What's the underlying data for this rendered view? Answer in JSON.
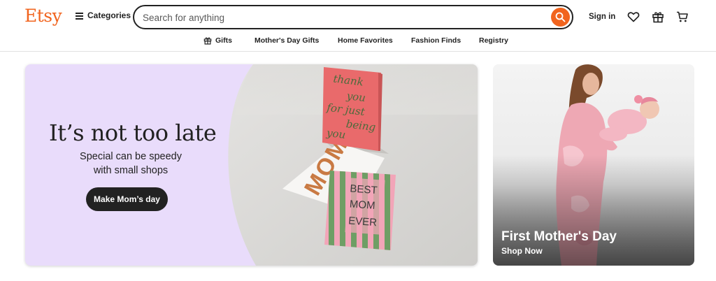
{
  "header": {
    "logo": "Etsy",
    "categories_label": "Categories",
    "search_placeholder": "Search for anything",
    "sign_in": "Sign in"
  },
  "nav": {
    "items": [
      {
        "label": "Gifts",
        "icon": "gift-icon"
      },
      {
        "label": "Mother's Day Gifts"
      },
      {
        "label": "Home Favorites"
      },
      {
        "label": "Fashion Finds"
      },
      {
        "label": "Registry"
      }
    ]
  },
  "hero": {
    "title": "It’s not too late",
    "subtitle_line1": "Special can be speedy",
    "subtitle_line2": "with small shops",
    "cta": "Make Mom’s day",
    "card_pink_text": [
      "thank",
      "you",
      "for just",
      "being",
      "you"
    ],
    "card_mom_text": "MOM",
    "card_striped_text": [
      "BEST",
      "MOM",
      "EVER"
    ]
  },
  "promo": {
    "title": "First Mother's Day",
    "link": "Shop Now"
  },
  "colors": {
    "brand": "#f1641e",
    "hero_bg": "#e9dcfb",
    "button_dark": "#222222"
  }
}
